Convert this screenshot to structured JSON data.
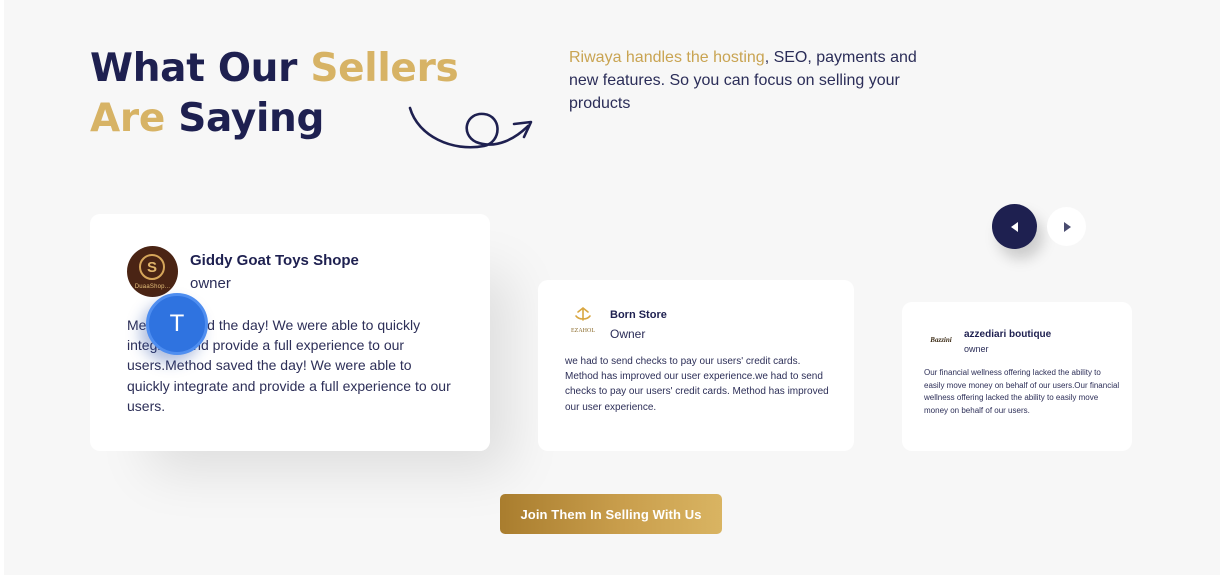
{
  "heading": {
    "line1_part1": "What Our ",
    "line1_part2": "Sellers",
    "line2_part1": "Are",
    "line2_part2": " Saying"
  },
  "intro": {
    "highlight": "Riwaya handles the hosting",
    "rest": ", SEO, payments and new features. So you can focus on selling your products"
  },
  "testimonials": [
    {
      "name": "Giddy Goat Toys Shope",
      "role": "owner",
      "logo_text": "S",
      "logo_brand": "DuaaShop...",
      "quote": "Method saved the day! We were able to quickly integrate and provide a full experience to our users.Method saved the day! We were able to quickly integrate and provide a full experience to our users."
    },
    {
      "name": "Born Store",
      "role": "Owner",
      "logo_brand": "EZAHOL",
      "quote": "we had to send checks to pay our users' credit cards. Method has improved our user experience.we had to send checks to pay our users' credit cards. Method has improved our user experience."
    },
    {
      "name": "azzediari boutique",
      "role": "owner",
      "logo_brand": "Bazzini",
      "quote": "Our financial wellness offering lacked the ability to easily move money on behalf of our users.Our financial wellness offering lacked the ability to easily move money on behalf of our users."
    }
  ],
  "overlay_avatar": {
    "letter": "T"
  },
  "carousel": {
    "prev_icon": "triangle-left-icon",
    "next_icon": "triangle-right-icon"
  },
  "cta": {
    "label": "Join Them In Selling With Us"
  },
  "colors": {
    "navy": "#1e2050",
    "gold": "#d7b365",
    "background": "#f7f7f7",
    "avatar_blue": "#2f73e0"
  }
}
